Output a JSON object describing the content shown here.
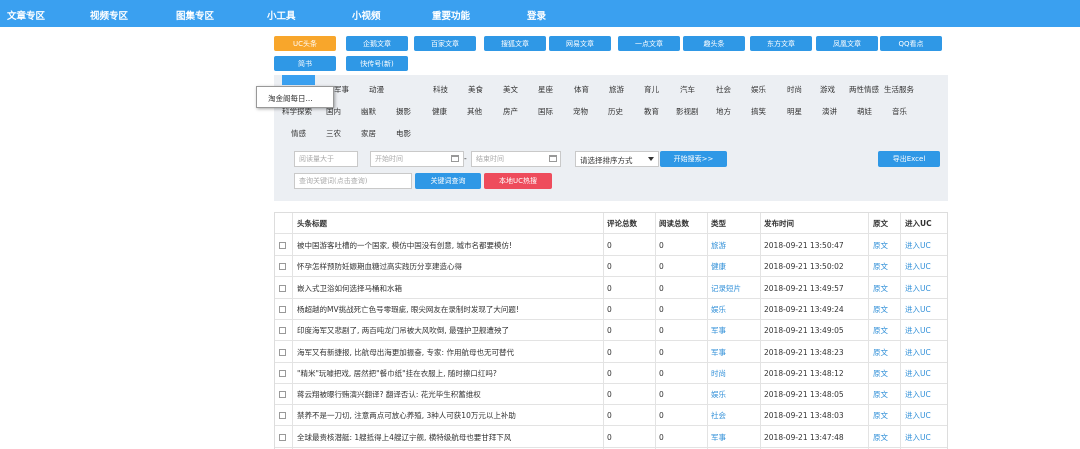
{
  "nav": [
    "文章专区",
    "视频专区",
    "图集专区",
    "小工具",
    "小视频",
    "重要功能",
    "登录"
  ],
  "buttons_row1": [
    "UC头条",
    "企鹅文章",
    "百家文章",
    "搜狐文章",
    "网易文章",
    "一点文章",
    "趣头条",
    "东方文章",
    "凤凰文章",
    "QQ看点"
  ],
  "buttons_row2": [
    "简书",
    "快传号(新)"
  ],
  "popup": {
    "text": "淘金阁每日..."
  },
  "categories": [
    [
      "军事",
      "动漫",
      "科技",
      "美食",
      "美文",
      "星座",
      "体育",
      "旅游",
      "育儿",
      "汽车",
      "社会",
      "娱乐",
      "时尚",
      "游戏",
      "两性情感",
      "生活服务"
    ],
    [
      "科学探索",
      "国内",
      "幽默",
      "摄影",
      "健康",
      "其他",
      "房产",
      "国际",
      "宠物",
      "历史",
      "教育",
      "影视剧",
      "地方",
      "搞笑",
      "明星",
      "演讲",
      "萌娃",
      "音乐"
    ],
    [
      "情感",
      "三农",
      "家居",
      "电影"
    ]
  ],
  "filters": {
    "read_placeholder": "阅读量大于",
    "start_placeholder": "开始时间",
    "end_placeholder": "结束时间",
    "sort_value": "请选择排序方式",
    "search_label": "开始搜索>>",
    "export_label": "导出Excel",
    "keyword_placeholder": "查询关键词(点击查询)",
    "keyword_button": "关键词查询",
    "local_button": "本地UC热搜"
  },
  "table": {
    "headers": [
      "头条标题",
      "评论总数",
      "阅读总数",
      "类型",
      "发布时间",
      "原文",
      "进入UC"
    ],
    "rows": [
      [
        "被中国游客吐槽的一个国家, 模仿中国没有创意, 城市名都要模仿!",
        "0",
        "0",
        "旅游",
        "2018-09-21 13:50:47",
        "原文",
        "进入UC"
      ],
      [
        "怀孕怎样预防妊娠期血糖过高实践历分享建造心得",
        "0",
        "0",
        "健康",
        "2018-09-21 13:50:02",
        "原文",
        "进入UC"
      ],
      [
        "嵌入式卫浴如何选择马桶和水箱",
        "0",
        "0",
        "记录短片",
        "2018-09-21 13:49:57",
        "原文",
        "进入UC"
      ],
      [
        "杨超越的MV挑战死亡色号零瑕疵, 眼尖网友在录制时发现了大问题!",
        "0",
        "0",
        "娱乐",
        "2018-09-21 13:49:24",
        "原文",
        "进入UC"
      ],
      [
        "印度海军又悲剧了, 两百吨龙门吊被大风吹倒, 最强护卫舰遭殃了",
        "0",
        "0",
        "军事",
        "2018-09-21 13:49:05",
        "原文",
        "进入UC"
      ],
      [
        "海军又有新捷报, 比航母出海更加振奋, 专家: 作用航母也无可替代",
        "0",
        "0",
        "军事",
        "2018-09-21 13:48:23",
        "原文",
        "进入UC"
      ],
      [
        "\"精米\"玩噱把戏, 居然把\"餐巾纸\"挂在衣服上, 随时擦口红吗?",
        "0",
        "0",
        "时尚",
        "2018-09-21 13:48:12",
        "原文",
        "进入UC"
      ],
      [
        "蒋云翔被曝行贿演兴翻译? 翻译否认: 花光毕生积蓄维权",
        "0",
        "0",
        "娱乐",
        "2018-09-21 13:48:05",
        "原文",
        "进入UC"
      ],
      [
        "禁养不是一刀切, 注意两点可放心养殖, 3种人可获10万元以上补助",
        "0",
        "0",
        "社会",
        "2018-09-21 13:48:03",
        "原文",
        "进入UC"
      ],
      [
        "全球最贵核潜艇: 1艘抵得上4艘辽宁舰, 横特级航母也要甘拜下风",
        "0",
        "0",
        "军事",
        "2018-09-21 13:47:48",
        "原文",
        "进入UC"
      ]
    ]
  },
  "colors": {
    "primary": "#3aa0f0",
    "button": "#2f98e6",
    "accent_orange": "#f8a62b",
    "accent_red": "#ee4c5c",
    "link": "#2f8fd8"
  }
}
